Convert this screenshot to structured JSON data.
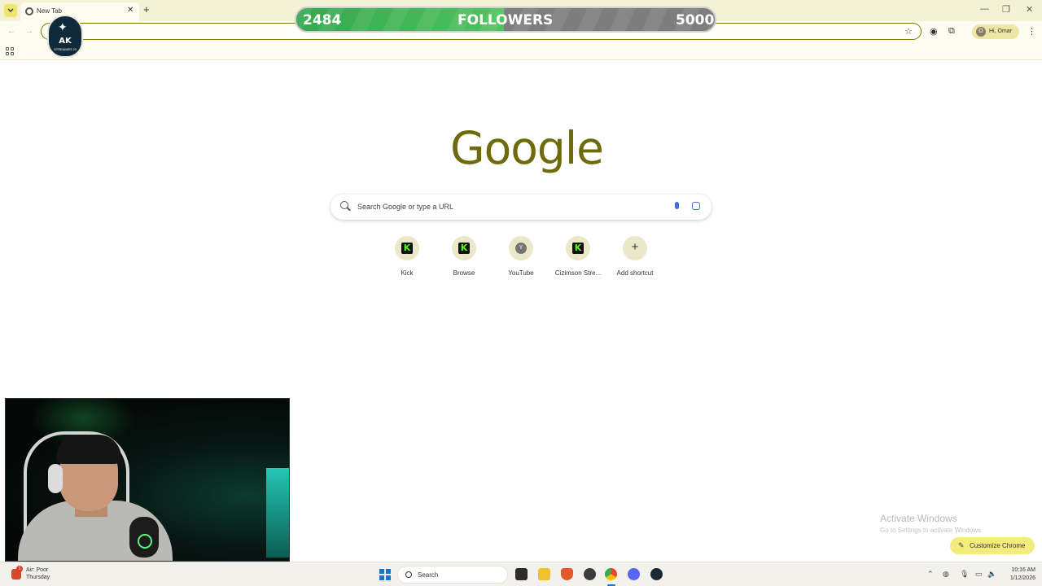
{
  "browser": {
    "tab": {
      "title": "New Tab"
    },
    "profile": {
      "initial": "O",
      "greeting": "Hi, Omar"
    }
  },
  "overlay": {
    "followers": {
      "current": "2484",
      "label": "FOLLOWERS",
      "goal": "5000",
      "progress": 0.497
    },
    "logo": {
      "text": "AK",
      "subtitle": "STREAMER 20"
    }
  },
  "newtab": {
    "logo": "Google",
    "search_placeholder": "Search Google or type a URL",
    "shortcuts": [
      {
        "label": "Kick",
        "icon": "kick-icon"
      },
      {
        "label": "Browse",
        "icon": "kick-icon"
      },
      {
        "label": "YouTube",
        "icon": "youtube-icon",
        "letter": "Y"
      },
      {
        "label": "Cizimson Stre...",
        "icon": "kick-icon"
      },
      {
        "label": "Add shortcut",
        "icon": "plus-icon"
      }
    ],
    "customize_label": "Customize Chrome"
  },
  "watermark": {
    "title": "Activate Windows",
    "subtitle": "Go to Settings to activate Windows."
  },
  "taskbar": {
    "weather": {
      "line1": "Air: Poor",
      "line2": "Thursday",
      "badge": "1"
    },
    "search_label": "Search",
    "clock": {
      "time": "10:16 AM",
      "date": "1/12/2026"
    }
  },
  "colors": {
    "accent": "#7d7700",
    "followers_fill": "#3fb656",
    "kick_green": "#53fc18",
    "windows_blue": "#1a73d9"
  }
}
